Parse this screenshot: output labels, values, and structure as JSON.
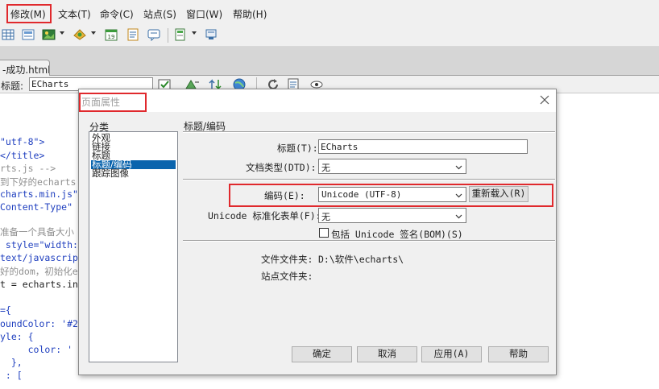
{
  "menubar": {
    "items": [
      "修改(M)",
      "文本(T)",
      "命令(C)",
      "站点(S)",
      "窗口(W)",
      "帮助(H)"
    ]
  },
  "tab": {
    "label": "-成功.html"
  },
  "doc_toolbar": {
    "title_label": "标题:",
    "title_value": "ECharts"
  },
  "code_lines": [
    "\"utf-8\">",
    "</title>",
    "rts.js -->",
    "到下好的echarts.",
    "charts.min.js\"",
    "Content-Type\"",
    "",
    "准备一个具备大小",
    " style=\"width:",
    "text/javascrip",
    "好的dom，初始化e",
    "t = echarts.in",
    "",
    "={",
    "oundColor: '#2",
    "yle: {",
    "     color: '",
    "  },",
    " : ["
  ],
  "dialog": {
    "title": "页面属性",
    "category_label": "分类",
    "categories": [
      "外观",
      "链接",
      "标题",
      "标题/编码",
      "跟踪图像"
    ],
    "selected_category": "标题/编码",
    "section_title": "标题/编码",
    "title_field": {
      "label": "标题(T):",
      "value": "ECharts"
    },
    "doctype_field": {
      "label": "文档类型(DTD):",
      "value": "无"
    },
    "encoding_field": {
      "label": "编码(E):",
      "value": "Unicode (UTF-8)"
    },
    "reload_button": "重新载入(R)",
    "normalization_field": {
      "label": "Unicode 标准化表单(F):",
      "value": "无"
    },
    "bom_checkbox": {
      "label": "包括 Unicode 签名(BOM)(S)",
      "checked": false
    },
    "doc_folder_label": "文件文件夹:",
    "doc_folder_value": "D:\\软件\\echarts\\",
    "site_folder_label": "站点文件夹:",
    "site_folder_value": "",
    "buttons": {
      "ok": "确定",
      "cancel": "取消",
      "apply": "应用(A)",
      "help": "帮助"
    }
  },
  "colors": {
    "highlight": "#e0292d",
    "selection": "#0a64ad",
    "string": "#1f3fbf",
    "comment": "#909090",
    "dialog_bg": "#f0f0f0"
  }
}
